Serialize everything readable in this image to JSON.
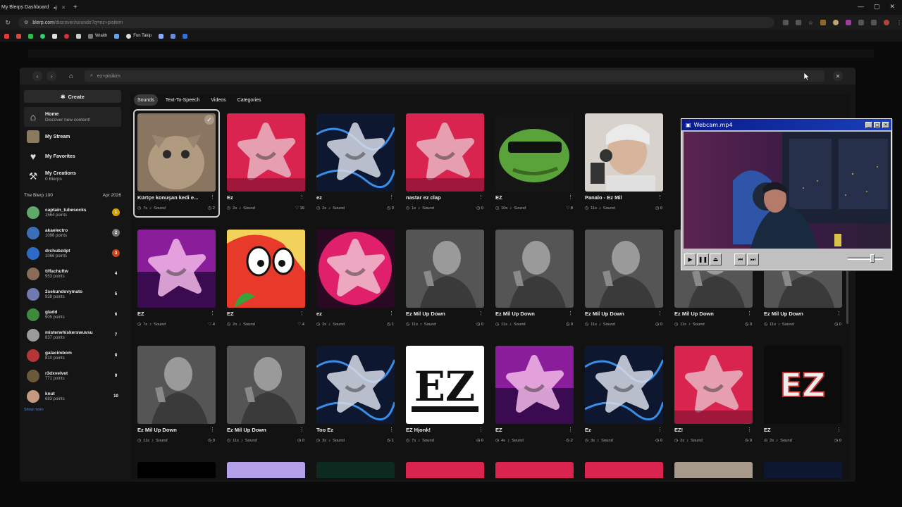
{
  "browser": {
    "tab_title": "My Blerps Dashboard",
    "url_host": "blerp.com",
    "url_path": "/discover/sounds?q=ez+pisikim",
    "bookmarks": [
      "Wraith",
      "Fon Takip"
    ]
  },
  "modal": {
    "search_value": "ez+pisikim"
  },
  "sidebar": {
    "create_label": "Create",
    "nav": [
      {
        "title": "Home",
        "sub": "Discover new content!"
      },
      {
        "title": "My Stream",
        "sub": ""
      },
      {
        "title": "My Favorites",
        "sub": ""
      },
      {
        "title": "My Creations",
        "sub": "0 Blerps"
      }
    ],
    "leaderboard_title": "The Blerp 100",
    "leaderboard_date": "Apr 2026",
    "leaders": [
      {
        "name": "captain_tubesocks",
        "points": "1564 points",
        "rank": "1",
        "color": "#d6a100",
        "avatar": "#5fa86a"
      },
      {
        "name": "akaelectro",
        "points": "1096 points",
        "rank": "2",
        "color": "#777777",
        "avatar": "#3b6fb5"
      },
      {
        "name": "drchubzdpt",
        "points": "1066 points",
        "rank": "3",
        "color": "#c4461d",
        "avatar": "#2e6bc9"
      },
      {
        "name": "tiffachuftw",
        "points": "953 points",
        "rank": "4",
        "color": "",
        "avatar": "#8a6b58"
      },
      {
        "name": "2sekundovymato",
        "points": "938 points",
        "rank": "5",
        "color": "",
        "avatar": "#6f7bb0"
      },
      {
        "name": "gladd",
        "points": "905 points",
        "rank": "6",
        "color": "",
        "avatar": "#3c8a3c"
      },
      {
        "name": "misterwhiskerswuvsu",
        "points": "837 points",
        "rank": "7",
        "color": "",
        "avatar": "#9b9b9b"
      },
      {
        "name": "galacimbom",
        "points": "810 points",
        "rank": "8",
        "color": "",
        "avatar": "#b53636"
      },
      {
        "name": "r3dxvelvet",
        "points": "771 points",
        "rank": "9",
        "color": "",
        "avatar": "#6b5a3a"
      },
      {
        "name": "knut",
        "points": "683 points",
        "rank": "10",
        "color": "",
        "avatar": "#c49a80"
      }
    ],
    "show_more": "Show more"
  },
  "filters": [
    "Sounds",
    "Text-To-Speech",
    "Videos",
    "Categories"
  ],
  "cards": [
    {
      "title": "Kürtçe konuşan kedi e...",
      "dur": "7s",
      "type": "Sound",
      "count": "2",
      "icon": "play",
      "thumb": "cat"
    },
    {
      "title": "Ez",
      "dur": "2s",
      "type": "Sound",
      "count": "16",
      "icon": "heart",
      "thumb": "pink"
    },
    {
      "title": "ez",
      "dur": "2s",
      "type": "Sound",
      "count": "0",
      "icon": "play",
      "thumb": "blue"
    },
    {
      "title": "nastar ez clap",
      "dur": "1s",
      "type": "Sound",
      "count": "0",
      "icon": "play",
      "thumb": "pink"
    },
    {
      "title": "EZ",
      "dur": "10s",
      "type": "Sound",
      "count": "8",
      "icon": "heart",
      "thumb": "pepe"
    },
    {
      "title": "Panalo - Ez Mil",
      "dur": "11s",
      "type": "Sound",
      "count": "0",
      "icon": "play",
      "thumb": "singer"
    },
    {
      "title": "EZ",
      "dur": "7s",
      "type": "Sound",
      "count": "4",
      "icon": "heart",
      "thumb": "purple"
    },
    {
      "title": "EZ",
      "dur": "2s",
      "type": "Sound",
      "count": "4",
      "icon": "heart",
      "thumb": "bird"
    },
    {
      "title": "ez",
      "dur": "2s",
      "type": "Sound",
      "count": "1",
      "icon": "play",
      "thumb": "magenta"
    },
    {
      "title": "Ez Mil Up Down",
      "dur": "11s",
      "type": "Sound",
      "count": "0",
      "icon": "play",
      "thumb": "bw"
    },
    {
      "title": "Ez Mil Up Down",
      "dur": "11s",
      "type": "Sound",
      "count": "0",
      "icon": "play",
      "thumb": "bw"
    },
    {
      "title": "Ez Mil Up Down",
      "dur": "11s",
      "type": "Sound",
      "count": "0",
      "icon": "play",
      "thumb": "bw"
    },
    {
      "title": "Ez Mil Up Down",
      "dur": "11s",
      "type": "Sound",
      "count": "0",
      "icon": "play",
      "thumb": "bw"
    },
    {
      "title": "Ez Mil Up Down",
      "dur": "11s",
      "type": "Sound",
      "count": "0",
      "icon": "play",
      "thumb": "bw"
    },
    {
      "title": "Ez Mil Up Down",
      "dur": "11s",
      "type": "Sound",
      "count": "0",
      "icon": "play",
      "thumb": "bw"
    },
    {
      "title": "Ez Mil Up Down",
      "dur": "11s",
      "type": "Sound",
      "count": "0",
      "icon": "play",
      "thumb": "bw"
    },
    {
      "title": "Too Ez",
      "dur": "3s",
      "type": "Sound",
      "count": "1",
      "icon": "play",
      "thumb": "blue"
    },
    {
      "title": "EZ Hjonk!",
      "dur": "7s",
      "type": "Sound",
      "count": "0",
      "icon": "play",
      "thumb": "eztext"
    },
    {
      "title": "EZ",
      "dur": "4s",
      "type": "Sound",
      "count": "2",
      "icon": "play",
      "thumb": "purple"
    },
    {
      "title": "Ez",
      "dur": "3s",
      "type": "Sound",
      "count": "0",
      "icon": "play",
      "thumb": "blue"
    },
    {
      "title": "EZ!",
      "dur": "2s",
      "type": "Sound",
      "count": "0",
      "icon": "play",
      "thumb": "pink"
    },
    {
      "title": "EZ",
      "dur": "2s",
      "type": "Sound",
      "count": "0",
      "icon": "play",
      "thumb": "ezlogo"
    }
  ],
  "webcam": {
    "title": "Webcam.mp4"
  }
}
